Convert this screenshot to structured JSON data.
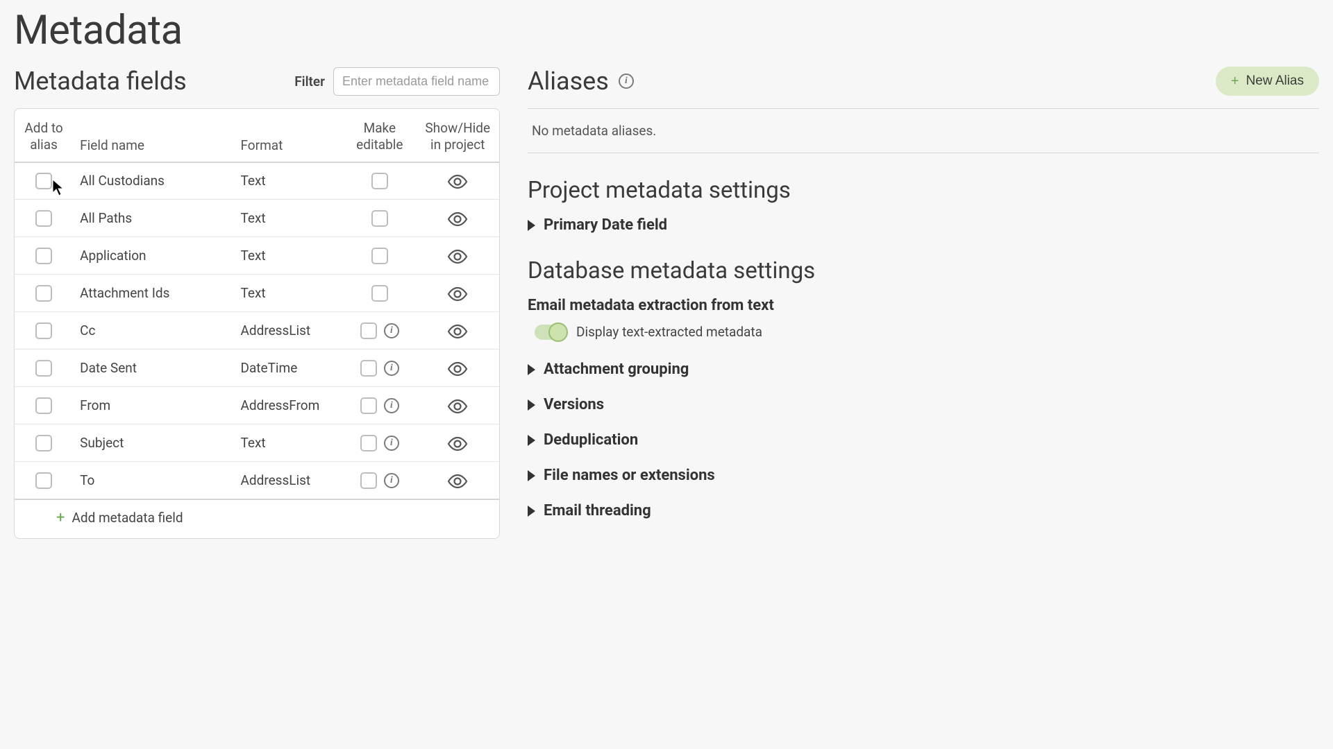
{
  "page": {
    "title": "Metadata"
  },
  "fields": {
    "section_title": "Metadata fields",
    "filter_label": "Filter",
    "filter_placeholder": "Enter metadata field name",
    "columns": {
      "add_to_alias_l1": "Add to",
      "add_to_alias_l2": "alias",
      "field_name": "Field name",
      "format": "Format",
      "make_editable_l1": "Make",
      "make_editable_l2": "editable",
      "show_hide_l1": "Show/Hide",
      "show_hide_l2": "in project"
    },
    "rows": [
      {
        "name": "All Custodians",
        "format": "Text",
        "has_info": false
      },
      {
        "name": "All Paths",
        "format": "Text",
        "has_info": false
      },
      {
        "name": "Application",
        "format": "Text",
        "has_info": false
      },
      {
        "name": "Attachment Ids",
        "format": "Text",
        "has_info": false
      },
      {
        "name": "Cc",
        "format": "AddressList",
        "has_info": true
      },
      {
        "name": "Date Sent",
        "format": "DateTime",
        "has_info": true
      },
      {
        "name": "From",
        "format": "AddressFrom",
        "has_info": true
      },
      {
        "name": "Subject",
        "format": "Text",
        "has_info": true
      },
      {
        "name": "To",
        "format": "AddressList",
        "has_info": true
      }
    ],
    "add_field_label": "Add metadata field"
  },
  "aliases": {
    "title": "Aliases",
    "new_button": "New Alias",
    "empty_text": "No metadata aliases."
  },
  "project_settings": {
    "heading": "Project metadata settings",
    "primary_date": "Primary Date field"
  },
  "db_settings": {
    "heading": "Database metadata settings",
    "email_extraction": "Email metadata extraction from text",
    "toggle_label": "Display text-extracted metadata",
    "disclosures": [
      "Attachment grouping",
      "Versions",
      "Deduplication",
      "File names or extensions",
      "Email threading"
    ]
  }
}
